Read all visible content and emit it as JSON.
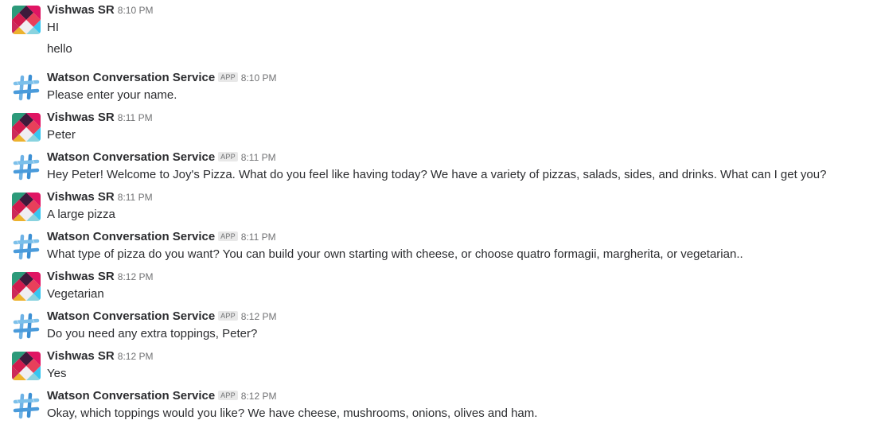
{
  "messages": [
    {
      "author": "Vishwas SR",
      "is_app": false,
      "time": "8:10 PM",
      "lines": [
        "HI",
        "hello"
      ]
    },
    {
      "author": "Watson Conversation Service",
      "is_app": true,
      "badge": "APP",
      "time": "8:10 PM",
      "lines": [
        "Please enter your name."
      ]
    },
    {
      "author": "Vishwas SR",
      "is_app": false,
      "time": "8:11 PM",
      "lines": [
        "Peter"
      ]
    },
    {
      "author": "Watson Conversation Service",
      "is_app": true,
      "badge": "APP",
      "time": "8:11 PM",
      "lines": [
        "Hey Peter! Welcome to Joy's Pizza. What do you feel like having today? We have a variety of pizzas, salads, sides, and drinks. What can I get you?"
      ]
    },
    {
      "author": "Vishwas SR",
      "is_app": false,
      "time": "8:11 PM",
      "lines": [
        "A large pizza"
      ]
    },
    {
      "author": "Watson Conversation Service",
      "is_app": true,
      "badge": "APP",
      "time": "8:11 PM",
      "lines": [
        "What type of pizza do you want? You can build your own starting with cheese, or choose quatro formagii, margherita, or vegetarian.."
      ]
    },
    {
      "author": "Vishwas SR",
      "is_app": false,
      "time": "8:12 PM",
      "lines": [
        "Vegetarian"
      ]
    },
    {
      "author": "Watson Conversation Service",
      "is_app": true,
      "badge": "APP",
      "time": "8:12 PM",
      "lines": [
        "Do you need any extra toppings, Peter?"
      ]
    },
    {
      "author": "Vishwas SR",
      "is_app": false,
      "time": "8:12 PM",
      "lines": [
        "Yes"
      ]
    },
    {
      "author": "Watson Conversation Service",
      "is_app": true,
      "badge": "APP",
      "time": "8:12 PM",
      "lines": [
        "Okay, which toppings would you like? We have cheese, mushrooms, onions, olives and ham."
      ]
    }
  ],
  "icons": {
    "user_avatar": "user-avatar-icon",
    "app_avatar": "slack-hash-icon"
  }
}
